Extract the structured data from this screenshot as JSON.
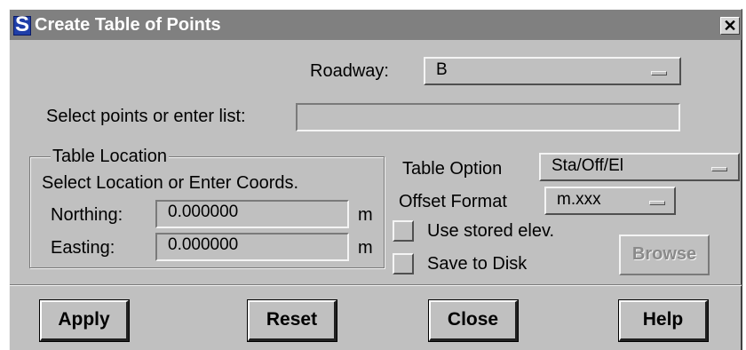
{
  "window": {
    "title": "Create Table of Points",
    "app_icon": "app-logo-icon",
    "close_glyph": "✕"
  },
  "roadway": {
    "label": "Roadway:",
    "value": "B"
  },
  "select_points": {
    "label": "Select points or enter list:",
    "value": ""
  },
  "table_location": {
    "group_title": "Table Location",
    "instruction": "Select Location or Enter Coords.",
    "northing": {
      "label": "Northing:",
      "value": "0.000000",
      "unit": "m"
    },
    "easting": {
      "label": "Easting:",
      "value": "0.000000",
      "unit": "m"
    }
  },
  "table_option": {
    "label": "Table Option",
    "value": "Sta/Off/El"
  },
  "offset_format": {
    "label": "Offset Format",
    "value": "m.xxx"
  },
  "checkboxes": {
    "use_stored_elev": {
      "label": "Use stored elev.",
      "checked": false
    },
    "save_to_disk": {
      "label": "Save to Disk",
      "checked": false
    }
  },
  "browse_label": "Browse",
  "buttons": {
    "apply": "Apply",
    "reset": "Reset",
    "close": "Close",
    "help": "Help"
  },
  "colors": {
    "dialog_bg": "#c0c0c0",
    "titlebar_bg": "#808080",
    "icon_blue": "#1f3ea8"
  }
}
